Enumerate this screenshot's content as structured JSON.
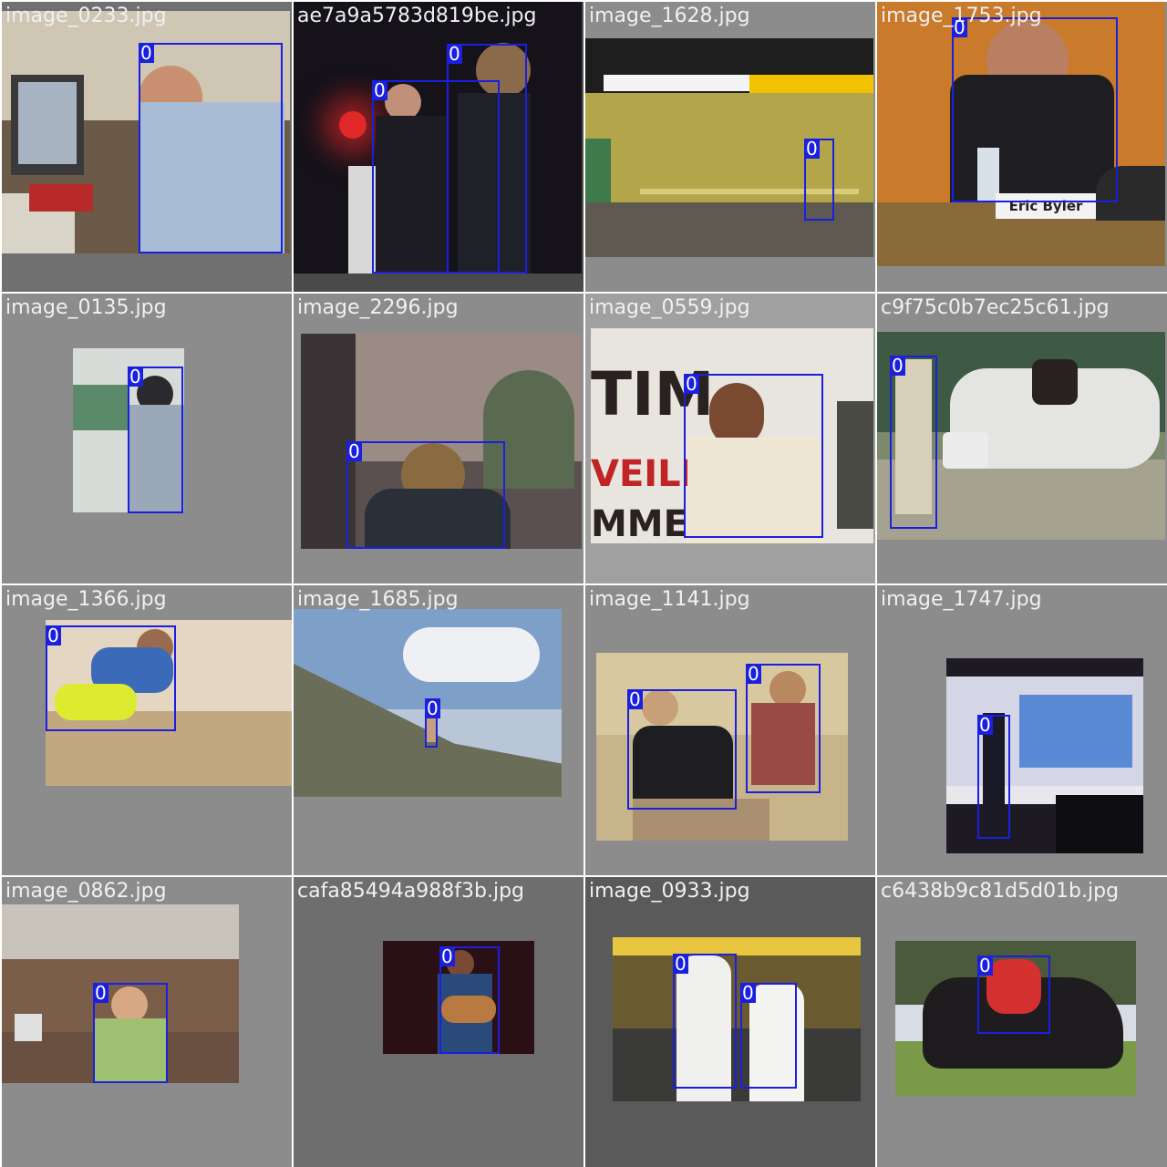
{
  "tiles": [
    {
      "filename": "image_0233.jpg",
      "boxes": [
        {
          "label": "0"
        }
      ]
    },
    {
      "filename": "ae7a9a5783d819be.jpg",
      "boxes": [
        {
          "label": "0"
        },
        {
          "label": "0"
        }
      ]
    },
    {
      "filename": "image_1628.jpg",
      "boxes": [
        {
          "label": "0"
        }
      ]
    },
    {
      "filename": "image_1753.jpg",
      "boxes": [
        {
          "label": "0"
        }
      ],
      "name_plate": "Eric Byler"
    },
    {
      "filename": "image_0135.jpg",
      "boxes": [
        {
          "label": "0"
        }
      ]
    },
    {
      "filename": "image_2296.jpg",
      "boxes": [
        {
          "label": "0"
        }
      ]
    },
    {
      "filename": "image_0559.jpg",
      "boxes": [
        {
          "label": "0"
        }
      ],
      "sign_text": [
        "TIM",
        "VEILL",
        "MME ("
      ]
    },
    {
      "filename": "c9f75c0b7ec25c61.jpg",
      "boxes": [
        {
          "label": "0"
        }
      ]
    },
    {
      "filename": "image_1366.jpg",
      "boxes": [
        {
          "label": "0"
        }
      ]
    },
    {
      "filename": "image_1685.jpg",
      "boxes": [
        {
          "label": "0"
        }
      ]
    },
    {
      "filename": "image_1141.jpg",
      "boxes": [
        {
          "label": "0"
        },
        {
          "label": "0"
        }
      ]
    },
    {
      "filename": "image_1747.jpg",
      "boxes": [
        {
          "label": "0"
        }
      ]
    },
    {
      "filename": "image_0862.jpg",
      "boxes": [
        {
          "label": "0"
        }
      ]
    },
    {
      "filename": "cafa85494a988f3b.jpg",
      "boxes": [
        {
          "label": "0"
        }
      ]
    },
    {
      "filename": "image_0933.jpg",
      "boxes": [
        {
          "label": "0"
        },
        {
          "label": "0"
        }
      ]
    },
    {
      "filename": "c6438b9c81d5d01b.jpg",
      "boxes": [
        {
          "label": "0"
        }
      ]
    }
  ],
  "colors": {
    "box": "#1a1fe0",
    "background": "#8c8c8c",
    "text": "#f0f0f0"
  }
}
